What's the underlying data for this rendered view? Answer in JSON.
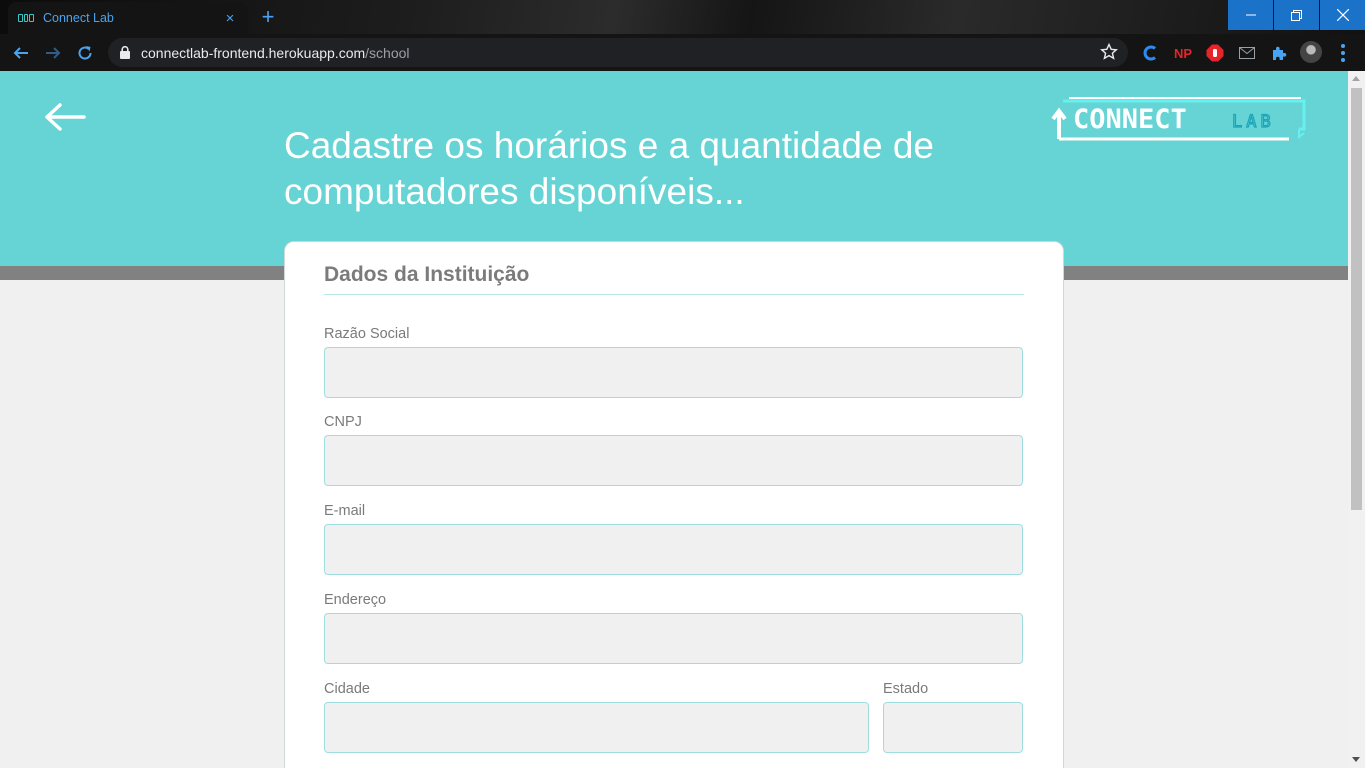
{
  "browser": {
    "tab_title": "Connect Lab",
    "tab_close": "×",
    "new_tab": "+",
    "url_host": "connectlab-frontend.herokuapp.com",
    "url_path": "/school",
    "extensions": {
      "np_label": "NP"
    }
  },
  "colors": {
    "hero": "#66d3d4",
    "accent": "#9edede",
    "browser_blue": "#1a73c9"
  },
  "page": {
    "heading": "Cadastre os horários e a quantidade de computadores disponíveis...",
    "logo": {
      "main": "CONNECT",
      "accent": "LAB"
    }
  },
  "form": {
    "title": "Dados da Instituição",
    "fields": {
      "razao_social": {
        "label": "Razão Social",
        "value": ""
      },
      "cnpj": {
        "label": "CNPJ",
        "value": ""
      },
      "email": {
        "label": "E-mail",
        "value": ""
      },
      "endereco": {
        "label": "Endereço",
        "value": ""
      },
      "cidade": {
        "label": "Cidade",
        "value": ""
      },
      "estado": {
        "label": "Estado",
        "value": ""
      }
    }
  }
}
